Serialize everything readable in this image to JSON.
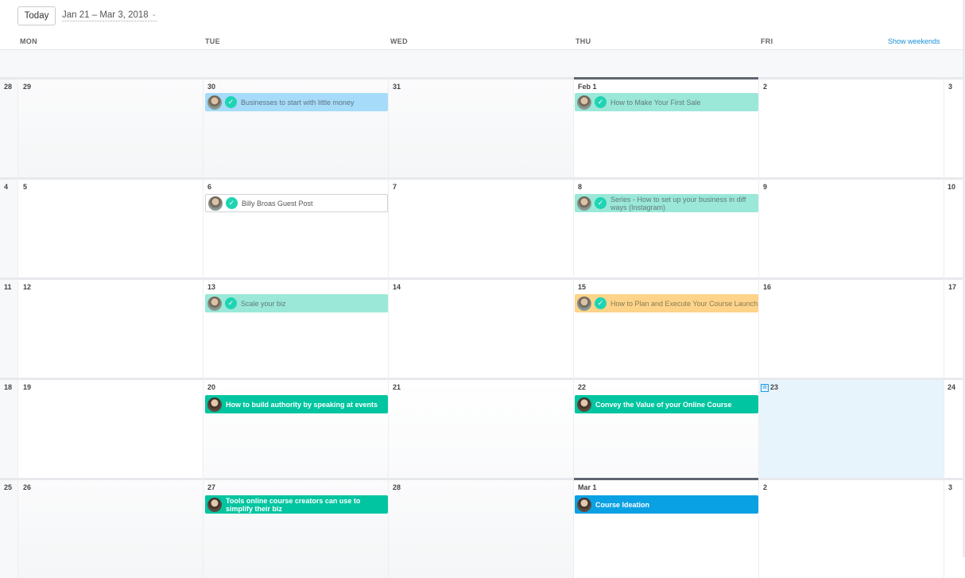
{
  "toolbar": {
    "today_label": "Today",
    "date_range": "Jan 21 – Mar 3, 2018",
    "show_weekends": "Show weekends"
  },
  "days_of_week": [
    "MON",
    "TUE",
    "WED",
    "THU",
    "FRI"
  ],
  "weeks": [
    {
      "sunday": "28",
      "saturday": "3",
      "days": [
        "29",
        "30",
        "31",
        "Feb 1",
        "2"
      ]
    },
    {
      "sunday": "4",
      "saturday": "10",
      "days": [
        "5",
        "6",
        "7",
        "8",
        "9"
      ]
    },
    {
      "sunday": "11",
      "saturday": "17",
      "days": [
        "12",
        "13",
        "14",
        "15",
        "16"
      ]
    },
    {
      "sunday": "18",
      "saturday": "24",
      "days": [
        "19",
        "20",
        "21",
        "22",
        "23"
      ]
    },
    {
      "sunday": "25",
      "saturday": "3",
      "days": [
        "26",
        "27",
        "28",
        "Mar 1",
        "2"
      ]
    }
  ],
  "events": {
    "w0_tue": {
      "title": "Businesses to start with little money",
      "color": "#a6dcf9",
      "status": "completed"
    },
    "w0_thu": {
      "title": "How to Make Your First Sale",
      "color": "#9be8d8",
      "status": "completed"
    },
    "w1_tue": {
      "title": "Billy Broas Guest Post",
      "color": "#ffffff",
      "status": "completed"
    },
    "w1_thu": {
      "title": "Series - How to set up your business in diff ways (Instagram)",
      "color": "#9be8d8",
      "status": "completed"
    },
    "w2_tue": {
      "title": "Scale your biz",
      "color": "#9be8d8",
      "status": "completed"
    },
    "w2_thu": {
      "title": "How to Plan and Execute Your Course Launch",
      "color": "#fdd48a",
      "status": "completed"
    },
    "w3_tue": {
      "title": "How to build authority by speaking at events",
      "color": "#00c5a0",
      "status": "incomplete"
    },
    "w3_thu": {
      "title": "Convey the Value of your Online Course",
      "color": "#00c5a0",
      "status": "incomplete"
    },
    "w4_tue": {
      "title": "Tools online course creators can use to simplify their biz",
      "color": "#00c5a0",
      "status": "incomplete"
    },
    "w4_thu": {
      "title": "Course Ideation",
      "color": "#0aa1e4",
      "status": "incomplete"
    }
  },
  "icons": {
    "check": "check-circle-icon",
    "today_marker": "star-icon",
    "avatar": "user-avatar"
  }
}
